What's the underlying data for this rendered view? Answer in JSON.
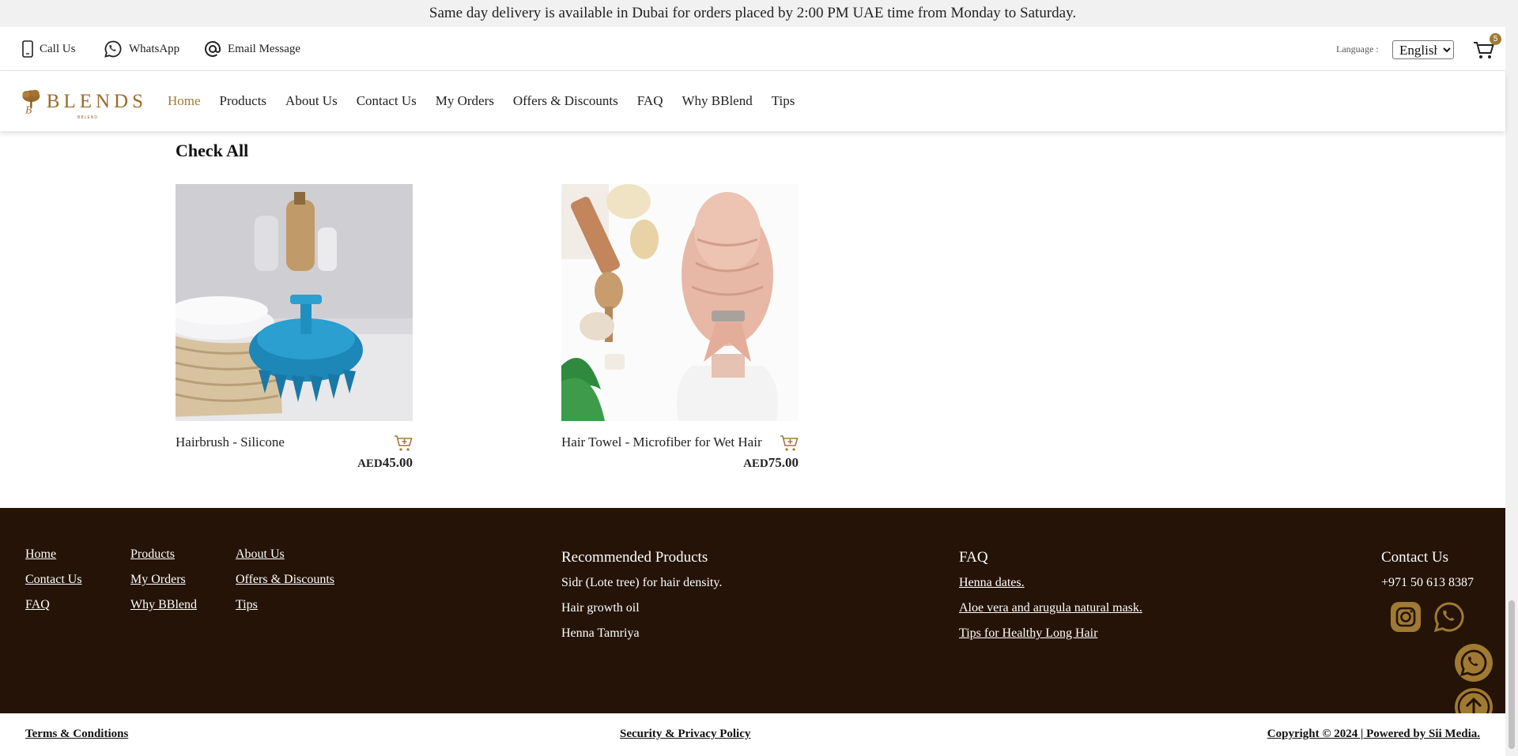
{
  "announcement": "Same day delivery is available in Dubai for orders placed by 2:00 PM UAE time from Monday to Saturday.",
  "contact_bar": {
    "call": "Call Us",
    "whatsapp": "WhatsApp",
    "email": "Email Message",
    "language_label": "Language :",
    "language_selected": "English",
    "cart_count": "5"
  },
  "logo": {
    "text": "BLENDS",
    "tagline": "BBLEND"
  },
  "nav": {
    "items": [
      "Home",
      "Products",
      "About Us",
      "Contact Us",
      "My Orders",
      "Offers & Discounts",
      "FAQ",
      "Why BBlend",
      "Tips"
    ],
    "active": "Home"
  },
  "section_title": "Check All",
  "products": [
    {
      "name": "Hairbrush - Silicone",
      "currency": "AED",
      "price": "45.00"
    },
    {
      "name": "Hair Towel - Microfiber for Wet Hair",
      "currency": "AED",
      "price": "75.00"
    }
  ],
  "footer": {
    "links_col1": [
      "Home",
      "Contact Us",
      "FAQ"
    ],
    "links_col2": [
      "Products",
      "My Orders",
      "Why BBlend"
    ],
    "links_col3": [
      "About Us",
      "Offers & Discounts",
      "Tips"
    ],
    "recommended": {
      "heading": "Recommended Products",
      "items": [
        "Sidr (Lote tree) for hair density.",
        "Hair growth oil",
        "Henna Tamriya"
      ]
    },
    "faq": {
      "heading": "FAQ",
      "items": [
        "Henna dates.",
        "Aloe vera and arugula natural mask.",
        "Tips for Healthy Long Hair"
      ]
    },
    "contact": {
      "heading": "Contact Us",
      "phone": "+971 50 613 8387"
    }
  },
  "bottom": {
    "terms": "Terms & Conditions",
    "privacy": "Security & Privacy Policy",
    "copyright": "Copyright © 2024 | Powered by Sii Media."
  },
  "colors": {
    "accent": "#a07a32",
    "footer_bg": "#241306",
    "announce_bg": "#f1f1f1"
  },
  "icons": [
    "phone-icon",
    "whatsapp-icon",
    "at-icon",
    "cart-icon",
    "add-to-cart-icon",
    "instagram-icon",
    "arrow-up-icon"
  ]
}
